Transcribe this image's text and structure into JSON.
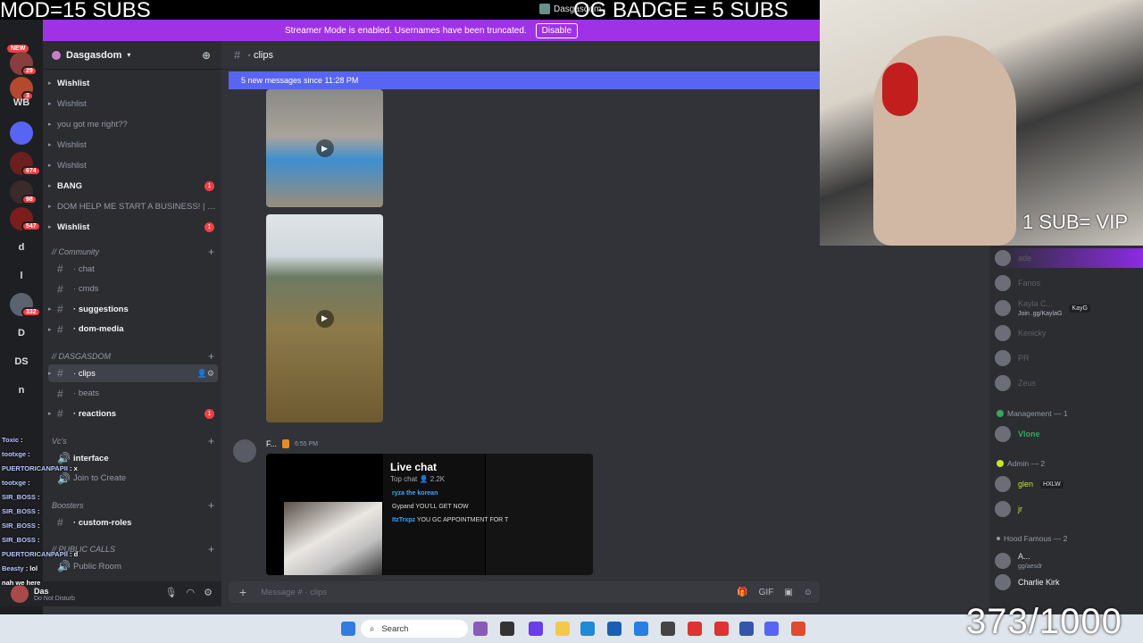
{
  "overlay": {
    "mod_text": "MOD=15 SUBS",
    "og_text": "OG BADGE = 5 SUBS",
    "vip_text": "1 SUB= VIP",
    "sub_count": "373/1000"
  },
  "window": {
    "app_title": "Dasgasdom"
  },
  "banner": {
    "text": "Streamer Mode is enabled. Usernames have been truncated.",
    "disable_label": "Disable"
  },
  "rail": {
    "new_badge": "NEW",
    "servers": [
      {
        "label": "",
        "count": "29"
      },
      {
        "label": "",
        "count": "3"
      },
      {
        "label": "WB",
        "count": ""
      },
      {
        "label": "",
        "count": ""
      },
      {
        "label": "",
        "count": "674"
      },
      {
        "label": "",
        "count": "98"
      },
      {
        "label": "",
        "count": "547"
      },
      {
        "label": "d",
        "count": ""
      },
      {
        "label": "l",
        "count": ""
      },
      {
        "label": "",
        "count": "332"
      },
      {
        "label": "D",
        "count": ""
      },
      {
        "label": "DS",
        "count": ""
      },
      {
        "label": "n",
        "count": ""
      }
    ]
  },
  "guild": {
    "name": "Dasgasdom"
  },
  "channels": [
    {
      "label": "Wishlist",
      "unread": true,
      "mention": ""
    },
    {
      "label": "Wishlist",
      "unread": false,
      "mention": ""
    },
    {
      "label": "you got me right??",
      "unread": false,
      "mention": ""
    },
    {
      "label": "Wishlist",
      "unread": false,
      "mention": ""
    },
    {
      "label": "Wishlist",
      "unread": false,
      "mention": ""
    },
    {
      "label": "BANG",
      "unread": true,
      "mention": "1"
    },
    {
      "label": "DOM HELP ME START A BUSINESS! | I'...",
      "unread": false,
      "mention": ""
    },
    {
      "label": "Wishlist",
      "unread": true,
      "mention": "1"
    }
  ],
  "categories": {
    "community": "// Community",
    "dasgasdom": "// DASGASDOM",
    "vcs": "Vc's",
    "boosters": "Boosters",
    "public_calls": "// PUBLIC CALLS"
  },
  "community_channels": [
    {
      "label": "chat"
    },
    {
      "label": "cmds"
    },
    {
      "label": "suggestions"
    },
    {
      "label": "dom-media"
    }
  ],
  "dasgasdom_channels": [
    {
      "label": "clips",
      "mention": ""
    },
    {
      "label": "beats",
      "mention": ""
    },
    {
      "label": "reactions",
      "mention": "1"
    }
  ],
  "vc_channels": [
    {
      "label": "interface"
    },
    {
      "label": "Join to Create"
    }
  ],
  "booster_channels": [
    {
      "label": "custom-roles"
    }
  ],
  "public_channels": [
    {
      "label": "Public Room"
    }
  ],
  "user": {
    "name": "Das",
    "status": "Do Not Disturb"
  },
  "channel_header": {
    "name": "clips"
  },
  "new_messages": "5 new messages since 11:28 PM",
  "message": {
    "author": "F...",
    "time": "6:55 PM"
  },
  "livechat": {
    "title": "Live chat",
    "subtitle": "Top chat",
    "viewers": "2.2K",
    "rows": [
      {
        "name": "ryza the korean",
        "text": ""
      },
      {
        "name": "Gypand",
        "text": "YOU'LL GET NOW"
      },
      {
        "name": "ItzTrxpz",
        "text": "YOU GC APPOINTMENT FOR T"
      }
    ]
  },
  "composer": {
    "placeholder": "Message # · clips"
  },
  "members": {
    "top_rows": [
      {
        "name": "ade"
      },
      {
        "name": "Fanos"
      },
      {
        "name": "Kayla C...",
        "tag": "KayG",
        "sub": "Join .gg/KaylaG"
      },
      {
        "name": "Kenicky"
      },
      {
        "name": "PR"
      },
      {
        "name": "Zeus"
      }
    ],
    "management": {
      "header": "Management — 1",
      "members": [
        {
          "name": "Vlone"
        }
      ]
    },
    "admin": {
      "header": "Admin — 2",
      "members": [
        {
          "name": "glen",
          "tag": "HXLW"
        },
        {
          "name": "jr"
        }
      ]
    },
    "hood": {
      "header": "Hood Famous — 2",
      "members": [
        {
          "name": "A...",
          "sub": "gg/aesdr"
        },
        {
          "name": "Charlie Kirk"
        }
      ]
    }
  },
  "chat_overlay": [
    {
      "name": "Toxic",
      "text": ""
    },
    {
      "name": "tootxge",
      "text": ""
    },
    {
      "name": "PUERTORICANPAPII",
      "text": "x"
    },
    {
      "name": "tootxge",
      "text": ""
    },
    {
      "name": "SIR_BOSS",
      "text": ""
    },
    {
      "name": "SIR_BOSS",
      "text": ""
    },
    {
      "name": "SIR_BOSS",
      "text": ""
    },
    {
      "name": "SIR_BOSS",
      "text": ""
    },
    {
      "name": "PUERTORICANPAPII",
      "text": "d"
    },
    {
      "name": "Beasty",
      "text": "lol"
    },
    {
      "name": "",
      "text": "nah we here"
    }
  ],
  "taskbar": {
    "search_label": "Search"
  }
}
